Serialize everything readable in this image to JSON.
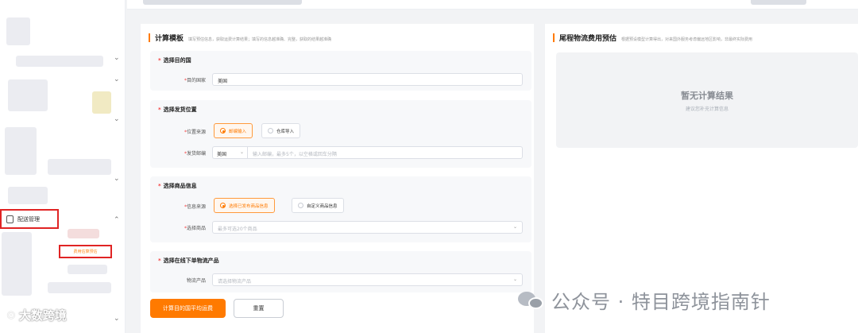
{
  "sidebar": {
    "active_menu_label": "配送管理",
    "active_submenu_label": "费用估算预估",
    "brand_text": "大数跨境"
  },
  "calc_panel": {
    "title": "计算模板",
    "description": "填写预估信息，获取运费计算结果；填写的信息越准确、完整，获取的结果越准确",
    "sections": {
      "destination": {
        "title": "选择目的国",
        "country_label": "目的国家",
        "country_value": "美国"
      },
      "origin": {
        "title": "选择发货位置",
        "source_label": "位置来源",
        "option_manual": "邮编输入",
        "option_warehouse": "仓库导入",
        "zip_label": "发货邮编",
        "zip_country": "美国",
        "zip_placeholder": "输入邮编，最多5个，以空格或回车分隔"
      },
      "product": {
        "title": "选择商品信息",
        "source_label": "信息来源",
        "option_published": "选择已发布商品信息",
        "option_custom": "自定义商品信息",
        "select_label": "选择商品",
        "select_placeholder": "最多可选20个商品"
      },
      "logistics": {
        "title": "选择在线下单物流产品",
        "product_label": "物流产品",
        "product_placeholder": "请选择物流产品"
      }
    },
    "buttons": {
      "calculate": "计算目的国平均运费",
      "reset": "重置"
    }
  },
  "result_panel": {
    "title": "尾程物流费用预估",
    "description": "根据预设模型计算得出，对来国外服务考虑偏远地区影响，非最终实际费用",
    "empty_title": "暂无计算结果",
    "empty_hint": "建议您补充计算信息"
  },
  "watermark": {
    "text": "公众号 · 特目跨境指南针"
  },
  "icons": {
    "menu_icon": "clipboard-icon",
    "chevron": "chevron-icon",
    "watermark_logo": "wechat-icon",
    "brand_logo": "brand-logo-icon"
  },
  "colors": {
    "accent": "#ff7a00",
    "highlight_box": "#e02424",
    "required": "#f53f3f"
  }
}
